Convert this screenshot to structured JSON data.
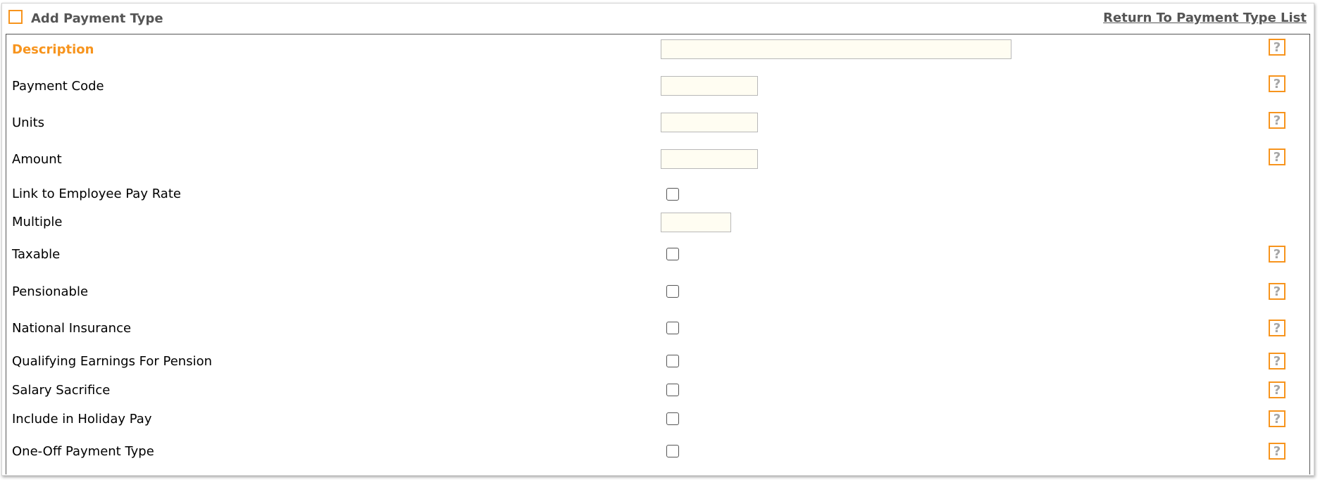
{
  "header": {
    "title": "Add Payment Type",
    "return_link": "Return To Payment Type List"
  },
  "help_glyph": "?",
  "colors": {
    "accent": "#f7941d",
    "text": "#555555",
    "input_bg": "#fffdf2"
  },
  "fields": {
    "description": {
      "label": "Description",
      "value": ""
    },
    "payment_code": {
      "label": "Payment Code",
      "value": ""
    },
    "units": {
      "label": "Units",
      "value": ""
    },
    "amount": {
      "label": "Amount",
      "value": ""
    },
    "link_pay_rate": {
      "label": "Link to Employee Pay Rate",
      "checked": false
    },
    "multiple": {
      "label": "Multiple",
      "value": ""
    },
    "taxable": {
      "label": "Taxable",
      "checked": false
    },
    "pensionable": {
      "label": "Pensionable",
      "checked": false
    },
    "national_insurance": {
      "label": "National Insurance",
      "checked": false
    },
    "qualifying_earnings": {
      "label": "Qualifying Earnings For Pension",
      "checked": false
    },
    "salary_sacrifice": {
      "label": "Salary Sacrifice",
      "checked": false
    },
    "holiday_pay": {
      "label": "Include in Holiday Pay",
      "checked": false
    },
    "one_off": {
      "label": "One-Off Payment Type",
      "checked": false
    }
  }
}
